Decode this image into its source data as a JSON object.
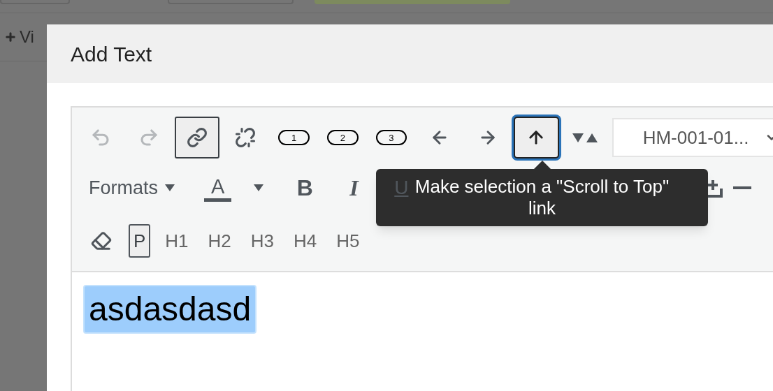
{
  "background": {
    "add_button_label": "Vi"
  },
  "dialog": {
    "title": "Add Text"
  },
  "toolbar_row_1": [
    {
      "kind": "undo",
      "disabled": true,
      "active": false
    },
    {
      "kind": "redo",
      "disabled": true,
      "active": false
    },
    {
      "kind": "link",
      "disabled": false,
      "active": true
    },
    {
      "kind": "unlink",
      "disabled": false,
      "active": false
    },
    {
      "kind": "pill",
      "label": "1",
      "disabled": false,
      "active": false
    },
    {
      "kind": "pill",
      "label": "2",
      "disabled": false,
      "active": false
    },
    {
      "kind": "pill",
      "label": "3",
      "disabled": false,
      "active": false
    },
    {
      "kind": "left",
      "disabled": false,
      "active": false
    },
    {
      "kind": "right",
      "disabled": false,
      "active": false
    },
    {
      "kind": "top",
      "disabled": false,
      "active": true
    },
    {
      "kind": "swap",
      "disabled": false,
      "active": false
    },
    {
      "kind": "select",
      "value": "HM-001-01..."
    }
  ],
  "toolbar_row_2": [
    {
      "kind": "formats",
      "label": "Formats"
    },
    {
      "kind": "color",
      "label": "A"
    },
    {
      "kind": "bold",
      "label": "B"
    },
    {
      "kind": "italic",
      "label": "I"
    },
    {
      "kind": "underline",
      "label": "U"
    },
    {
      "kind": "insert"
    },
    {
      "kind": "rule"
    }
  ],
  "format_blocks": [
    {
      "label": "P",
      "selected": true
    },
    {
      "label": "H1",
      "selected": false
    },
    {
      "label": "H2",
      "selected": false
    },
    {
      "label": "H3",
      "selected": false
    },
    {
      "label": "H4",
      "selected": false
    },
    {
      "label": "H5",
      "selected": false
    }
  ],
  "tooltip": {
    "text": "Make selection a \"Scroll to Top\" link"
  },
  "content": {
    "text": "asdasdasd",
    "selected": true
  }
}
